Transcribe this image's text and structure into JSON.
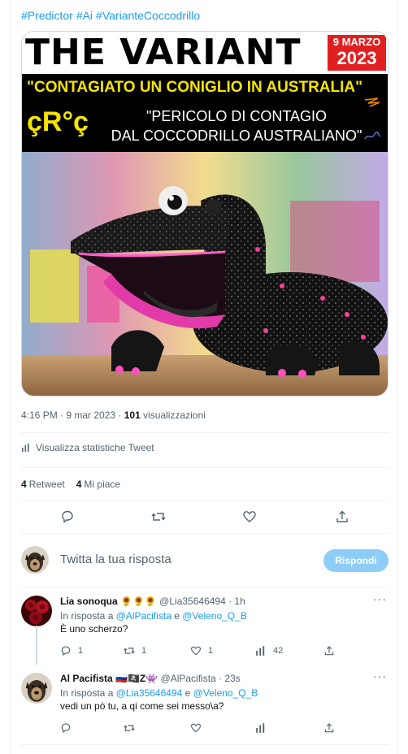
{
  "tweet": {
    "hashtags": [
      "#Predictor",
      "#Ai",
      "#VarianteCoccodrillo"
    ],
    "image": {
      "title": "THE VARIANT",
      "date_line1": "9 MARZO",
      "date_line2": "2023",
      "headline1": "\"CONTAGIATO UN CONIGLIO IN AUSTRALIA\"",
      "logo": "çR°ç",
      "headline2_line1": "\"PERICOLO DI CONTAGIO",
      "headline2_line2": "DAL COCCODRILLO AUSTRALIANO\""
    },
    "time": "4:16 PM · 9 mar 2023 · ",
    "views_count": "101",
    "views_label": " visualizzazioni",
    "stats_link": "Visualizza statistiche Tweet",
    "retweets_count": "4",
    "retweets_label": "Retweet",
    "likes_count": "4",
    "likes_label": "Mi piace"
  },
  "compose": {
    "placeholder": "Twitta la tua risposta",
    "button": "Rispondi"
  },
  "replies": [
    {
      "name": "Lia sonoqua 🌻🌻🌻",
      "handle": "@Lia35646494 · 1h",
      "reply_prefix": "In risposta a ",
      "reply_to_1": "@AlPacifista",
      "reply_join": " e ",
      "reply_to_2": "@Veleno_Q_B",
      "text": "È uno scherzo?",
      "reply_count": "1",
      "retweet_count": "1",
      "like_count": "1",
      "view_count": "42"
    },
    {
      "name": "Al Pacifista 🇷🇺🏴‍☠️Z👾",
      "handle": "@AlPacifista · 23s",
      "reply_prefix": "In risposta a ",
      "reply_to_1": "@Lia35646494",
      "reply_join": " e ",
      "reply_to_2": "@Veleno_Q_B",
      "text": "vedi un pò tu, a qi come sei messo\\a?",
      "reply_count": "",
      "retweet_count": "",
      "like_count": "",
      "view_count": ""
    }
  ],
  "icons": [
    "reply-icon",
    "retweet-icon",
    "like-icon",
    "share-icon",
    "views-icon",
    "more-icon",
    "stats-icon"
  ],
  "colors": {
    "link": "#1d9bf0",
    "muted": "#536471",
    "button": "#8ecdf7",
    "banner_yellow": "#f5e400",
    "banner_red": "#e02020"
  }
}
